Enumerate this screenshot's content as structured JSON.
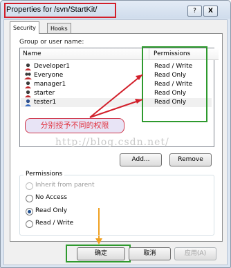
{
  "window": {
    "title": "Properties for /svn/StartKit/",
    "help_button": "?",
    "close_button": "X"
  },
  "tabs": [
    {
      "label": "Security",
      "active": true
    },
    {
      "label": "Hooks",
      "active": false
    }
  ],
  "group_label": "Group or user name:",
  "list": {
    "columns": [
      "Name",
      "Permissions"
    ],
    "rows": [
      {
        "name": "Developer1",
        "permission": "Read / Write"
      },
      {
        "name": "Everyone",
        "permission": "Read Only"
      },
      {
        "name": "manager1",
        "permission": "Read / Write"
      },
      {
        "name": "starter",
        "permission": "Read Only"
      },
      {
        "name": "tester1",
        "permission": "Read Only"
      }
    ]
  },
  "annotation": {
    "text": "分别授予不同的权限"
  },
  "watermark": "http://blog.csdn.net/",
  "buttons": {
    "add": "Add...",
    "remove": "Remove"
  },
  "permissions": {
    "label": "Permissions",
    "options": [
      {
        "label": "Inherit from parent",
        "checked": false,
        "enabled": false
      },
      {
        "label": "No Access",
        "checked": false,
        "enabled": true
      },
      {
        "label": "Read Only",
        "checked": true,
        "enabled": true
      },
      {
        "label": "Read / Write",
        "checked": false,
        "enabled": true
      }
    ]
  },
  "dialog_buttons": {
    "ok": "确定",
    "cancel": "取消",
    "apply": "应用(A)"
  },
  "colors": {
    "annotation_red": "#d21f2a",
    "annotation_green": "#2e9a2e",
    "arrow_orange": "#f0a020"
  }
}
